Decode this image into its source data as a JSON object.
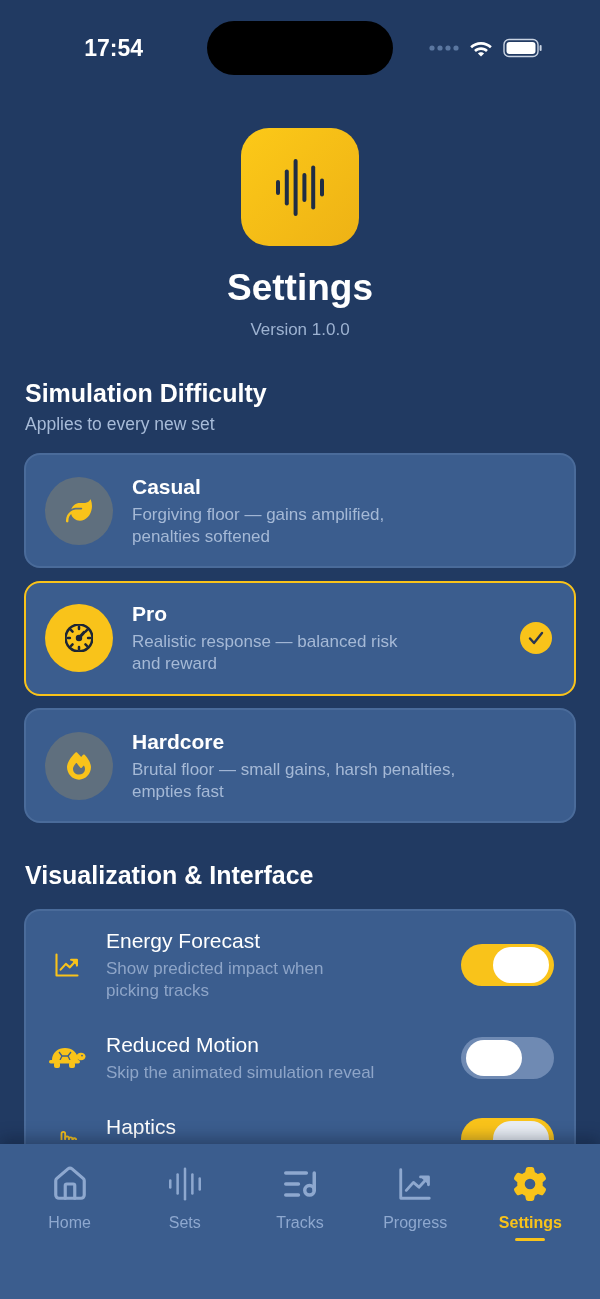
{
  "status_bar": {
    "time": "17:54"
  },
  "header": {
    "title": "Settings",
    "version": "Version 1.0.0"
  },
  "difficulty": {
    "title": "Simulation Difficulty",
    "subtitle": "Applies to every new set",
    "options": [
      {
        "title": "Casual",
        "description": "Forgiving floor — gains amplified, penalties softened",
        "selected": false
      },
      {
        "title": "Pro",
        "description": "Realistic response — balanced risk and reward",
        "selected": true
      },
      {
        "title": "Hardcore",
        "description": "Brutal floor — small gains, harsh penalties, empties fast",
        "selected": false
      }
    ]
  },
  "interface": {
    "title": "Visualization & Interface",
    "settings": [
      {
        "title": "Energy Forecast",
        "description": "Show predicted impact when picking tracks",
        "on": true
      },
      {
        "title": "Reduced Motion",
        "description": "Skip the animated simulation reveal",
        "on": false
      },
      {
        "title": "Haptics",
        "on": true
      }
    ]
  },
  "tab_bar": {
    "tabs": [
      {
        "label": "Home",
        "selected": false
      },
      {
        "label": "Sets",
        "selected": false
      },
      {
        "label": "Tracks",
        "selected": false
      },
      {
        "label": "Progress",
        "selected": false
      },
      {
        "label": "Settings",
        "selected": true
      }
    ]
  }
}
